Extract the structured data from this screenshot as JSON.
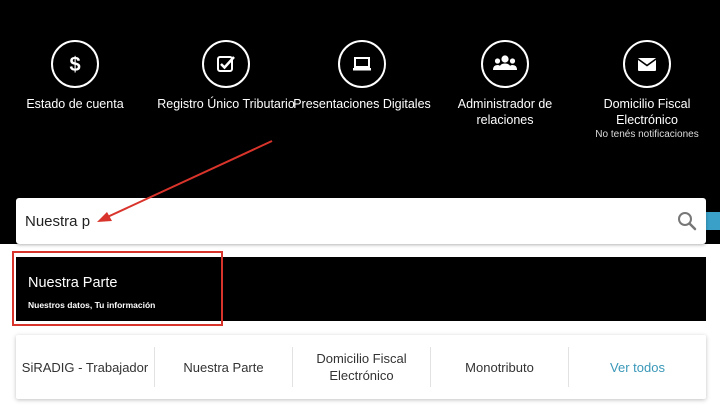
{
  "tiles": [
    {
      "label": "Estado de cuenta",
      "icon": "dollar-icon"
    },
    {
      "label": "Registro Único Tributario",
      "icon": "checkbox-icon"
    },
    {
      "label": "Presentaciones Digitales",
      "icon": "laptop-icon"
    },
    {
      "label": "Administrador de relaciones",
      "icon": "users-icon"
    },
    {
      "label": "Domicilio Fiscal Electrónico",
      "icon": "envelope-icon",
      "sub": "No tenés notificaciones"
    }
  ],
  "search": {
    "value": "Nuestra p"
  },
  "suggestion": {
    "title": "Nuestra Parte",
    "subtitle": "Nuestros datos, Tu información"
  },
  "shortcuts": [
    "SiRADIG - Trabajador",
    "Nuestra Parte",
    "Domicilio Fiscal Electrónico",
    "Monotributo"
  ],
  "see_all": "Ver todos",
  "colors": {
    "annotation": "#d9342b",
    "accent": "#3aa0c8",
    "link": "#3a98b8"
  }
}
